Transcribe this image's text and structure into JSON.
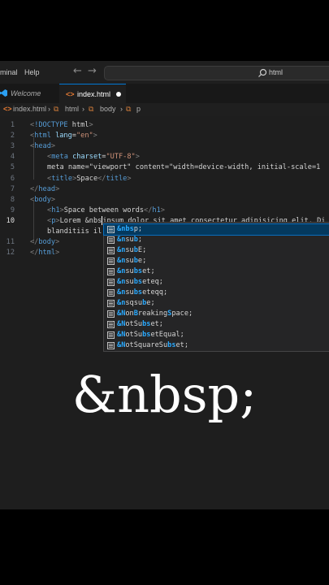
{
  "titlebar": {
    "menu": [
      "minal",
      "Help"
    ],
    "back_icon": "arrow-left-icon",
    "forward_icon": "arrow-right-icon",
    "search_text": "html"
  },
  "tabs": [
    {
      "label": "Welcome",
      "icon": "vscode-logo-icon"
    },
    {
      "label": "index.html",
      "icon": "html-file-icon",
      "modified": true
    }
  ],
  "breadcrumb": {
    "file": "index.html",
    "el1": "html",
    "el2": "body",
    "el3": "p"
  },
  "editor": {
    "line_numbers": [
      "1",
      "2",
      "3",
      "4",
      "5",
      "6",
      "7",
      "8",
      "9",
      "10",
      "",
      "11",
      "12"
    ],
    "active_line": "10",
    "lines": [
      "<!DOCTYPE html>",
      "<html lang=\"en\">",
      "<head>",
      "<meta charset=\"UTF-8\">",
      "<meta name=\"viewport\" content=\"width=device-width, initial-scale=1",
      "<title>Space</title>",
      "</head>",
      "<body>",
      "<h1>Space between words</h1>",
      "<p>Lorem &nbsipsum dolor sit amet consectetur adipisicing elit. Di",
      "blanditiis il",
      "</body>",
      "</html>"
    ]
  },
  "suggestions": {
    "items": [
      "&nbsp;",
      "&nsub;",
      "&nsubE;",
      "&nsube;",
      "&nsubset;",
      "&nsubseteq;",
      "&nsubseteqq;",
      "&nsqsube;",
      "&NonBreakingSpace;",
      "&NotSubset;",
      "&NotSubsetEqual;",
      "&NotSquareSubset;"
    ],
    "selected_index": 0
  },
  "overlay_caption": "&nbsp;",
  "colors": {
    "accent": "#0078d4",
    "highlight": "#2aaaff",
    "tag": "#569cd6",
    "attr": "#9cdcfe",
    "string": "#ce9178"
  }
}
